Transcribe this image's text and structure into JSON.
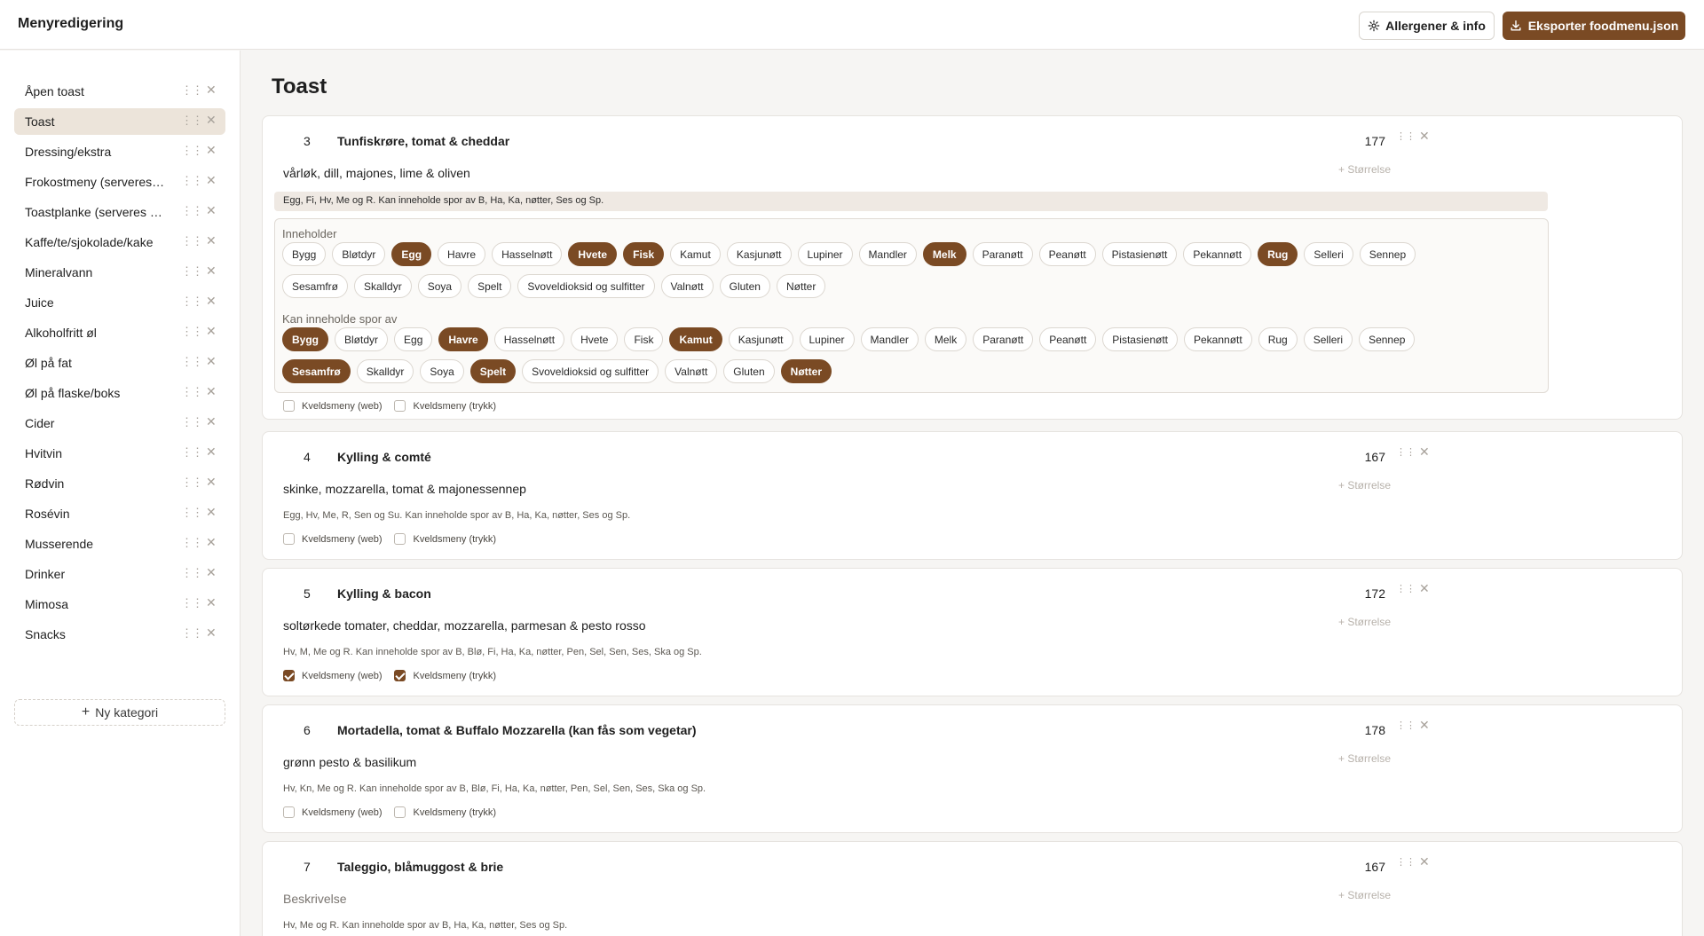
{
  "app": {
    "title": "Menyredigering"
  },
  "header": {
    "allergen_button": "Allergener & info",
    "export_button": "Eksporter foodmenu.json"
  },
  "sidebar": {
    "categories": [
      "Åpen toast",
      "Toast",
      "Dressing/ekstra",
      "Frokostmeny (serveres …",
      "Toastplanke (serveres 1…",
      "Kaffe/te/sjokolade/kake",
      "Mineralvann",
      "Juice",
      "Alkoholfritt øl",
      "Øl på fat",
      "Øl på flaske/boks",
      "Cider",
      "Hvitvin",
      "Rødvin",
      "Rosévin",
      "Musserende",
      "Drinker",
      "Mimosa",
      "Snacks"
    ],
    "active_index": 1,
    "new_category": "Ny kategori"
  },
  "main": {
    "title": "Toast",
    "size_label": "+ Størrelse",
    "contains_label": "Inneholder",
    "may_contain_label": "Kan inneholde spor av",
    "check_web": "Kveldsmeny (web)",
    "check_print": "Kveldsmeny (trykk)",
    "allergen_options": [
      "Bygg",
      "Bløtdyr",
      "Egg",
      "Havre",
      "Hasselnøtt",
      "Hvete",
      "Fisk",
      "Kamut",
      "Kasjunøtt",
      "Lupiner",
      "Mandler",
      "Melk",
      "Paranøtt",
      "Peanøtt",
      "Pistasienøtt",
      "Pekannøtt",
      "Rug",
      "Selleri",
      "Sennep",
      "Sesamfrø",
      "Skalldyr",
      "Soya",
      "Spelt",
      "Svoveldioksid og sulfitter",
      "Valnøtt",
      "Gluten",
      "Nøtter"
    ],
    "items": [
      {
        "number": "3",
        "name": "Tunfiskrøre, tomat & cheddar",
        "price": "177",
        "description": "vårløk, dill, majones, lime & oliven",
        "allergen_text": "Egg, Fi, Hv, Me og R. Kan inneholde spor av B, Ha, Ka, nøtter, Ses og Sp.",
        "contains": [
          "Egg",
          "Hvete",
          "Fisk",
          "Melk",
          "Rug"
        ],
        "may_contain": [
          "Bygg",
          "Havre",
          "Kamut",
          "Sesamfrø",
          "Spelt",
          "Nøtter"
        ],
        "web": false,
        "print": false
      },
      {
        "number": "4",
        "name": "Kylling & comté",
        "price": "167",
        "description": "skinke, mozzarella, tomat & majonessennep",
        "allergen_text": "Egg, Hv, Me, R, Sen og Su. Kan inneholde spor av B, Ha, Ka, nøtter, Ses og Sp.",
        "web": false,
        "print": false
      },
      {
        "number": "5",
        "name": "Kylling & bacon",
        "price": "172",
        "description": "soltørkede tomater, cheddar, mozzarella, parmesan & pesto rosso",
        "allergen_text": "Hv, M, Me og R. Kan inneholde spor av B, Blø, Fi, Ha, Ka, nøtter, Pen, Sel, Sen, Ses, Ska og Sp.",
        "web": true,
        "print": true
      },
      {
        "number": "6",
        "name": "Mortadella, tomat & Buffalo Mozzarella (kan fås som vegetar)",
        "price": "178",
        "description": "grønn pesto & basilikum",
        "allergen_text": "Hv, Kn, Me og R. Kan inneholde spor av B, Blø, Fi, Ha, Ka, nøtter, Pen, Sel, Sen, Ses, Ska og Sp.",
        "web": false,
        "print": false
      },
      {
        "number": "7",
        "name": "Taleggio, blåmuggost & brie",
        "price": "167",
        "description": "Beskrivelse",
        "allergen_text": "Hv, Me og R. Kan inneholde spor av B, Ha, Ka, nøtter, Ses og Sp."
      }
    ]
  },
  "colors": {
    "accent": "#7a4a24",
    "active_category_bg": "#ece4da",
    "page_bg": "#f6f5f3"
  },
  "icons": {
    "gear": "gear-icon",
    "download": "download-icon",
    "drag": "drag-handle-icon",
    "close": "close-icon",
    "plus": "plus-icon"
  }
}
